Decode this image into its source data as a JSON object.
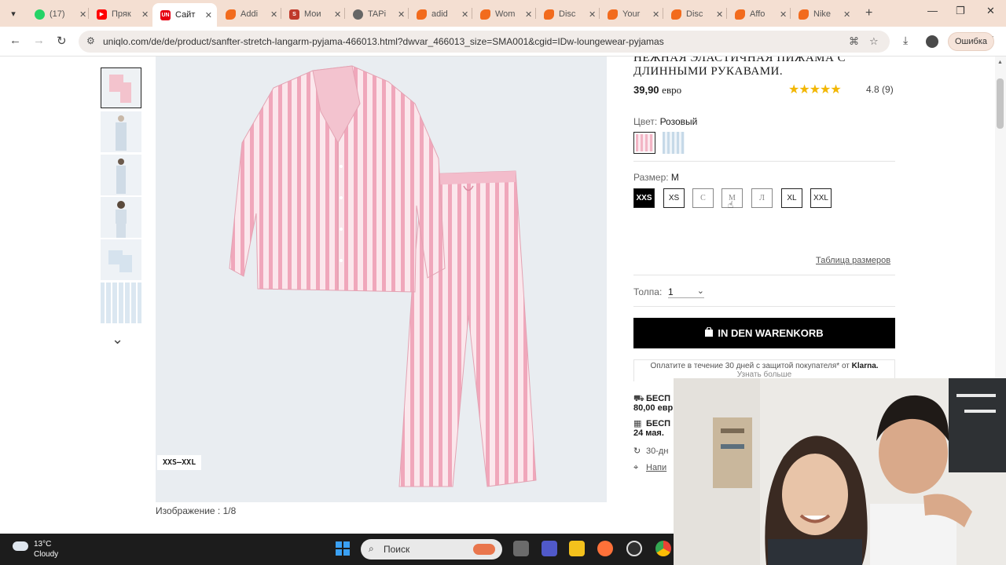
{
  "tabs": [
    {
      "title": "(17)",
      "favicon": "whatsapp-icon",
      "color": "#25d366"
    },
    {
      "title": "Пряк",
      "favicon": "youtube-icon",
      "color": "#ff0000"
    },
    {
      "title": "Сайт",
      "favicon": "uniqlo-icon",
      "color": "#e60012",
      "active": true
    },
    {
      "title": "Addi",
      "favicon": "play-icon",
      "color": "#f26b1d"
    },
    {
      "title": "Мои",
      "favicon": "s-icon",
      "color": "#c0392b"
    },
    {
      "title": "TAPi",
      "favicon": "globe-icon",
      "color": "#555555"
    },
    {
      "title": "adid",
      "favicon": "play-icon",
      "color": "#f26b1d"
    },
    {
      "title": "Wom",
      "favicon": "play-icon",
      "color": "#f26b1d"
    },
    {
      "title": "Disc",
      "favicon": "play-icon",
      "color": "#f26b1d"
    },
    {
      "title": "Your",
      "favicon": "play-icon",
      "color": "#f26b1d"
    },
    {
      "title": "Disc",
      "favicon": "play-icon",
      "color": "#f26b1d"
    },
    {
      "title": "Affo",
      "favicon": "play-icon",
      "color": "#f26b1d"
    },
    {
      "title": "Nike",
      "favicon": "play-icon",
      "color": "#f26b1d"
    }
  ],
  "browser": {
    "url": "uniqlo.com/de/de/product/sanfter-stretch-langarm-pyjama-466013.html?dwvar_466013_size=SMA001&cgid=IDw-loungewear-pyjamas",
    "error_label": "Ошибка"
  },
  "product": {
    "title": "НЕЖНАЯ ЭЛАСТИЧНАЯ ПИЖАМА С ДЛИННЫМИ РУКАВАМИ.",
    "price": "39,90",
    "currency": "евро",
    "rating": "4.8",
    "reviews": "(9)",
    "stars_glyph": "★★★★★",
    "color_label": "Цвет:",
    "color_value": "Розовый",
    "swatches": [
      "#f6c9d2",
      "#d9e6f0"
    ],
    "size_label": "Размер:",
    "size_value": "M",
    "sizes": [
      "XXS",
      "XS",
      "С",
      "М",
      "Л",
      "XL",
      "XXL"
    ],
    "size_table": "Таблица размеров",
    "qty_label": "Толпа:",
    "qty_value": "1",
    "cart_button": "IN DEN WARENKORB",
    "klarna_text": "Оплатите в течение 30 дней с защитой покупателя* от",
    "klarna_brand": "Klarna.",
    "klarna_more": "Узнать больше",
    "info": [
      {
        "icon": "truck-icon",
        "line1": "БЕСП",
        "line2": "80,00 евр"
      },
      {
        "icon": "store-icon",
        "line1": "БЕСП",
        "line2": "24 мая."
      },
      {
        "icon": "return-icon",
        "line1": "30-дн",
        "line2": ""
      },
      {
        "icon": "pin-icon",
        "line1": "Напи",
        "line2": ""
      }
    ],
    "image_chip": "XXS–XXL",
    "image_counter": "Изображение : 1/8"
  },
  "taskbar": {
    "temperature": "13°C",
    "weather": "Cloudy",
    "search_placeholder": "Поиск"
  }
}
